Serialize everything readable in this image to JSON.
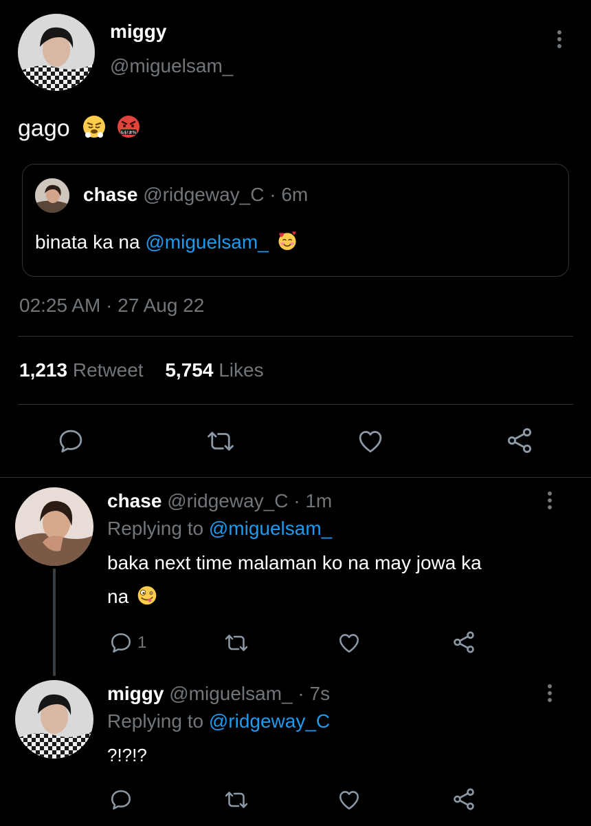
{
  "main_tweet": {
    "display_name": "miggy",
    "handle": "@miguelsam_",
    "text": "gago",
    "emojis": [
      "huffing-face-emoji",
      "cursing-face-emoji"
    ],
    "quoted": {
      "display_name": "chase",
      "handle": "@ridgeway_C",
      "separator": "·",
      "time": "6m",
      "text": "binata ka na",
      "mention": "@miguelsam_",
      "emoji": "smiling-face-with-hearts-emoji"
    },
    "timestamp": "02:25 AM · 27 Aug 22",
    "stats": {
      "retweets_count": "1,213",
      "retweets_label": "Retweet",
      "likes_count": "5,754",
      "likes_label": "Likes"
    }
  },
  "replies": [
    {
      "display_name": "chase",
      "handle": "@ridgeway_C",
      "separator": "·",
      "time": "1m",
      "replying_label": "Replying to",
      "replying_to": "@miguelsam_",
      "text_line1": "baka next time malaman ko na may jowa ka",
      "text_line2": "na",
      "emoji": "zany-face-emoji",
      "reply_count": "1"
    },
    {
      "display_name": "miggy",
      "handle": "@miguelsam_",
      "separator": "·",
      "time": "7s",
      "replying_label": "Replying to",
      "replying_to": "@ridgeway_C",
      "text_line1": "?!?!?"
    }
  ],
  "colors": {
    "background": "#000000",
    "text": "#e7e9ea",
    "muted": "#71767b",
    "link": "#1d9bf0",
    "divider": "#2f3336"
  }
}
